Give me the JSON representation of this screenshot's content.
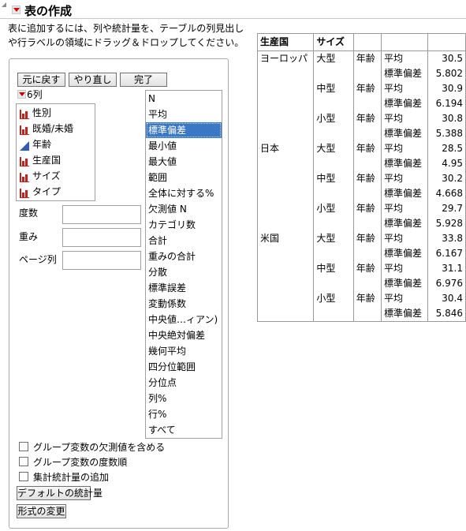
{
  "title": "表の作成",
  "instructions": "表に追加するには、列や統計量を、テーブルの列見出しや行ラベルの領域にドラッグ＆ドロップしてください。",
  "buttons": {
    "undo": "元に戻す",
    "redo": "やり直し",
    "done": "完了",
    "default_stats": "デフォルトの統計量",
    "change_format": "形式の変更"
  },
  "columns": {
    "count_label": "6列",
    "items": [
      {
        "label": "性別",
        "type": "nominal"
      },
      {
        "label": "既婚/未婚",
        "type": "nominal"
      },
      {
        "label": "年齢",
        "type": "continuous"
      },
      {
        "label": "生産国",
        "type": "nominal"
      },
      {
        "label": "サイズ",
        "type": "nominal"
      },
      {
        "label": "タイプ",
        "type": "nominal"
      }
    ]
  },
  "drop_zones": {
    "freq": "度数",
    "weight": "重み",
    "page": "ページ列"
  },
  "stats": {
    "selected": "標準偏差",
    "items": [
      "N",
      "平均",
      "標準偏差",
      "最小値",
      "最大値",
      "範囲",
      "全体に対する%",
      "欠測値 N",
      "カテゴリ数",
      "合計",
      "重みの合計",
      "分散",
      "標準誤差",
      "変動係数",
      "中央値…ィアン)",
      "中央絶対偏差",
      "幾何平均",
      "四分位範囲",
      "分位点",
      "列%",
      "行%",
      "すべて"
    ]
  },
  "checkboxes": [
    {
      "label": "グループ変数の欠測値を含める",
      "checked": false
    },
    {
      "label": "グループ変数の度数順",
      "checked": false
    },
    {
      "label": "集計統計量の追加",
      "checked": false
    }
  ],
  "table": {
    "headers": [
      "生産国",
      "サイズ",
      "",
      "",
      ""
    ],
    "rows": [
      [
        "ヨーロッパ",
        "大型",
        "年齢",
        "平均",
        "30.5"
      ],
      [
        "",
        "",
        "",
        "標準偏差",
        "5.802"
      ],
      [
        "",
        "中型",
        "年齢",
        "平均",
        "30.9"
      ],
      [
        "",
        "",
        "",
        "標準偏差",
        "6.194"
      ],
      [
        "",
        "小型",
        "年齢",
        "平均",
        "30.8"
      ],
      [
        "",
        "",
        "",
        "標準偏差",
        "5.388"
      ],
      [
        "日本",
        "大型",
        "年齢",
        "平均",
        "28.5"
      ],
      [
        "",
        "",
        "",
        "標準偏差",
        "4.95"
      ],
      [
        "",
        "中型",
        "年齢",
        "平均",
        "30.2"
      ],
      [
        "",
        "",
        "",
        "標準偏差",
        "4.668"
      ],
      [
        "",
        "小型",
        "年齢",
        "平均",
        "29.7"
      ],
      [
        "",
        "",
        "",
        "標準偏差",
        "5.928"
      ],
      [
        "米国",
        "大型",
        "年齢",
        "平均",
        "33.8"
      ],
      [
        "",
        "",
        "",
        "標準偏差",
        "6.167"
      ],
      [
        "",
        "中型",
        "年齢",
        "平均",
        "31.1"
      ],
      [
        "",
        "",
        "",
        "標準偏差",
        "6.976"
      ],
      [
        "",
        "小型",
        "年齢",
        "平均",
        "30.4"
      ],
      [
        "",
        "",
        "",
        "標準偏差",
        "5.846"
      ]
    ]
  },
  "colors": {
    "selection": "#3a78c6",
    "nominal_icon": "#c0221b",
    "continuous_icon": "#2f5fb5",
    "hotspot": "#d10000"
  }
}
